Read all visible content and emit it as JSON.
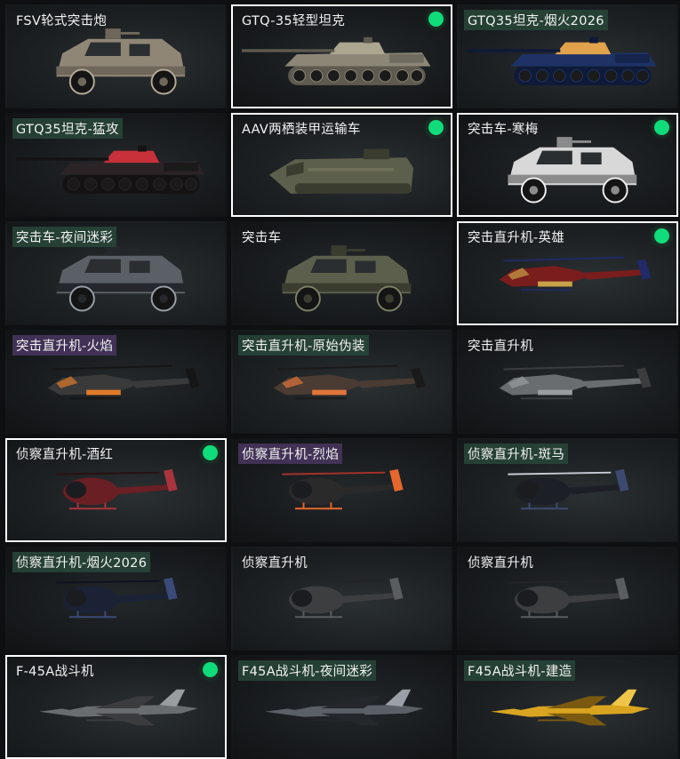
{
  "colors": {
    "selected_border": "#ffffff",
    "equipped_dot": "#0fdc7a",
    "label_tag_green": "#28463a",
    "label_tag_purple": "#46345c"
  },
  "cards": [
    {
      "label": "FSV轮式突击炮",
      "vehicle": "armored-car-icon",
      "skin": "desert",
      "selected": false,
      "equipped": false,
      "tag": "none"
    },
    {
      "label": "GTQ-35轻型坦克",
      "vehicle": "tank-icon",
      "skin": "tan",
      "selected": true,
      "equipped": true,
      "tag": "none"
    },
    {
      "label": "GTQ35坦克-烟火2026",
      "vehicle": "tank-icon",
      "skin": "fireworks",
      "selected": false,
      "equipped": false,
      "tag": "green"
    },
    {
      "label": "GTQ35坦克-猛攻",
      "vehicle": "tank-icon",
      "skin": "red",
      "selected": false,
      "equipped": false,
      "tag": "green"
    },
    {
      "label": "AAV两栖装甲运输车",
      "vehicle": "amphibious-carrier-icon",
      "skin": "olive",
      "selected": true,
      "equipped": true,
      "tag": "none"
    },
    {
      "label": "突击车-寒梅",
      "vehicle": "armored-car-icon",
      "skin": "white",
      "selected": true,
      "equipped": true,
      "tag": "none"
    },
    {
      "label": "突击车-夜间迷彩",
      "vehicle": "armored-car-icon",
      "skin": "night-camo",
      "selected": false,
      "equipped": false,
      "tag": "green"
    },
    {
      "label": "突击车",
      "vehicle": "armored-car-icon",
      "skin": "olive",
      "selected": false,
      "equipped": false,
      "tag": "none"
    },
    {
      "label": "突击直升机-英雄",
      "vehicle": "attack-helicopter-icon",
      "skin": "hero",
      "selected": true,
      "equipped": true,
      "tag": "none"
    },
    {
      "label": "突击直升机-火焰",
      "vehicle": "attack-helicopter-icon",
      "skin": "flame",
      "selected": false,
      "equipped": false,
      "tag": "purple"
    },
    {
      "label": "突击直升机-原始伪装",
      "vehicle": "attack-helicopter-icon",
      "skin": "orange-camo",
      "selected": false,
      "equipped": false,
      "tag": "green"
    },
    {
      "label": "突击直升机",
      "vehicle": "attack-helicopter-icon",
      "skin": "grey",
      "selected": false,
      "equipped": false,
      "tag": "none"
    },
    {
      "label": "侦察直升机-酒红",
      "vehicle": "scout-helicopter-icon",
      "skin": "wine-red",
      "selected": true,
      "equipped": true,
      "tag": "none"
    },
    {
      "label": "侦察直升机-烈焰",
      "vehicle": "scout-helicopter-icon",
      "skin": "blaze",
      "selected": false,
      "equipped": false,
      "tag": "purple"
    },
    {
      "label": "侦察直升机-斑马",
      "vehicle": "scout-helicopter-icon",
      "skin": "zebra",
      "selected": false,
      "equipped": false,
      "tag": "green"
    },
    {
      "label": "侦察直升机-烟火2026",
      "vehicle": "scout-helicopter-icon",
      "skin": "navy",
      "selected": false,
      "equipped": false,
      "tag": "green"
    },
    {
      "label": "侦察直升机",
      "vehicle": "scout-helicopter-icon",
      "skin": "dark-grey",
      "selected": false,
      "equipped": false,
      "tag": "none"
    },
    {
      "label": "侦察直升机",
      "vehicle": "scout-helicopter-icon",
      "skin": "dark-grey",
      "selected": false,
      "equipped": false,
      "tag": "none"
    },
    {
      "label": "F-45A战斗机",
      "vehicle": "fighter-jet-icon",
      "skin": "grey",
      "selected": true,
      "equipped": true,
      "tag": "none"
    },
    {
      "label": "F45A战斗机-夜间迷彩",
      "vehicle": "fighter-jet-icon",
      "skin": "night-camo",
      "selected": false,
      "equipped": false,
      "tag": "green"
    },
    {
      "label": "F45A战斗机-建造",
      "vehicle": "fighter-jet-icon",
      "skin": "yellow",
      "selected": false,
      "equipped": false,
      "tag": "green"
    }
  ]
}
